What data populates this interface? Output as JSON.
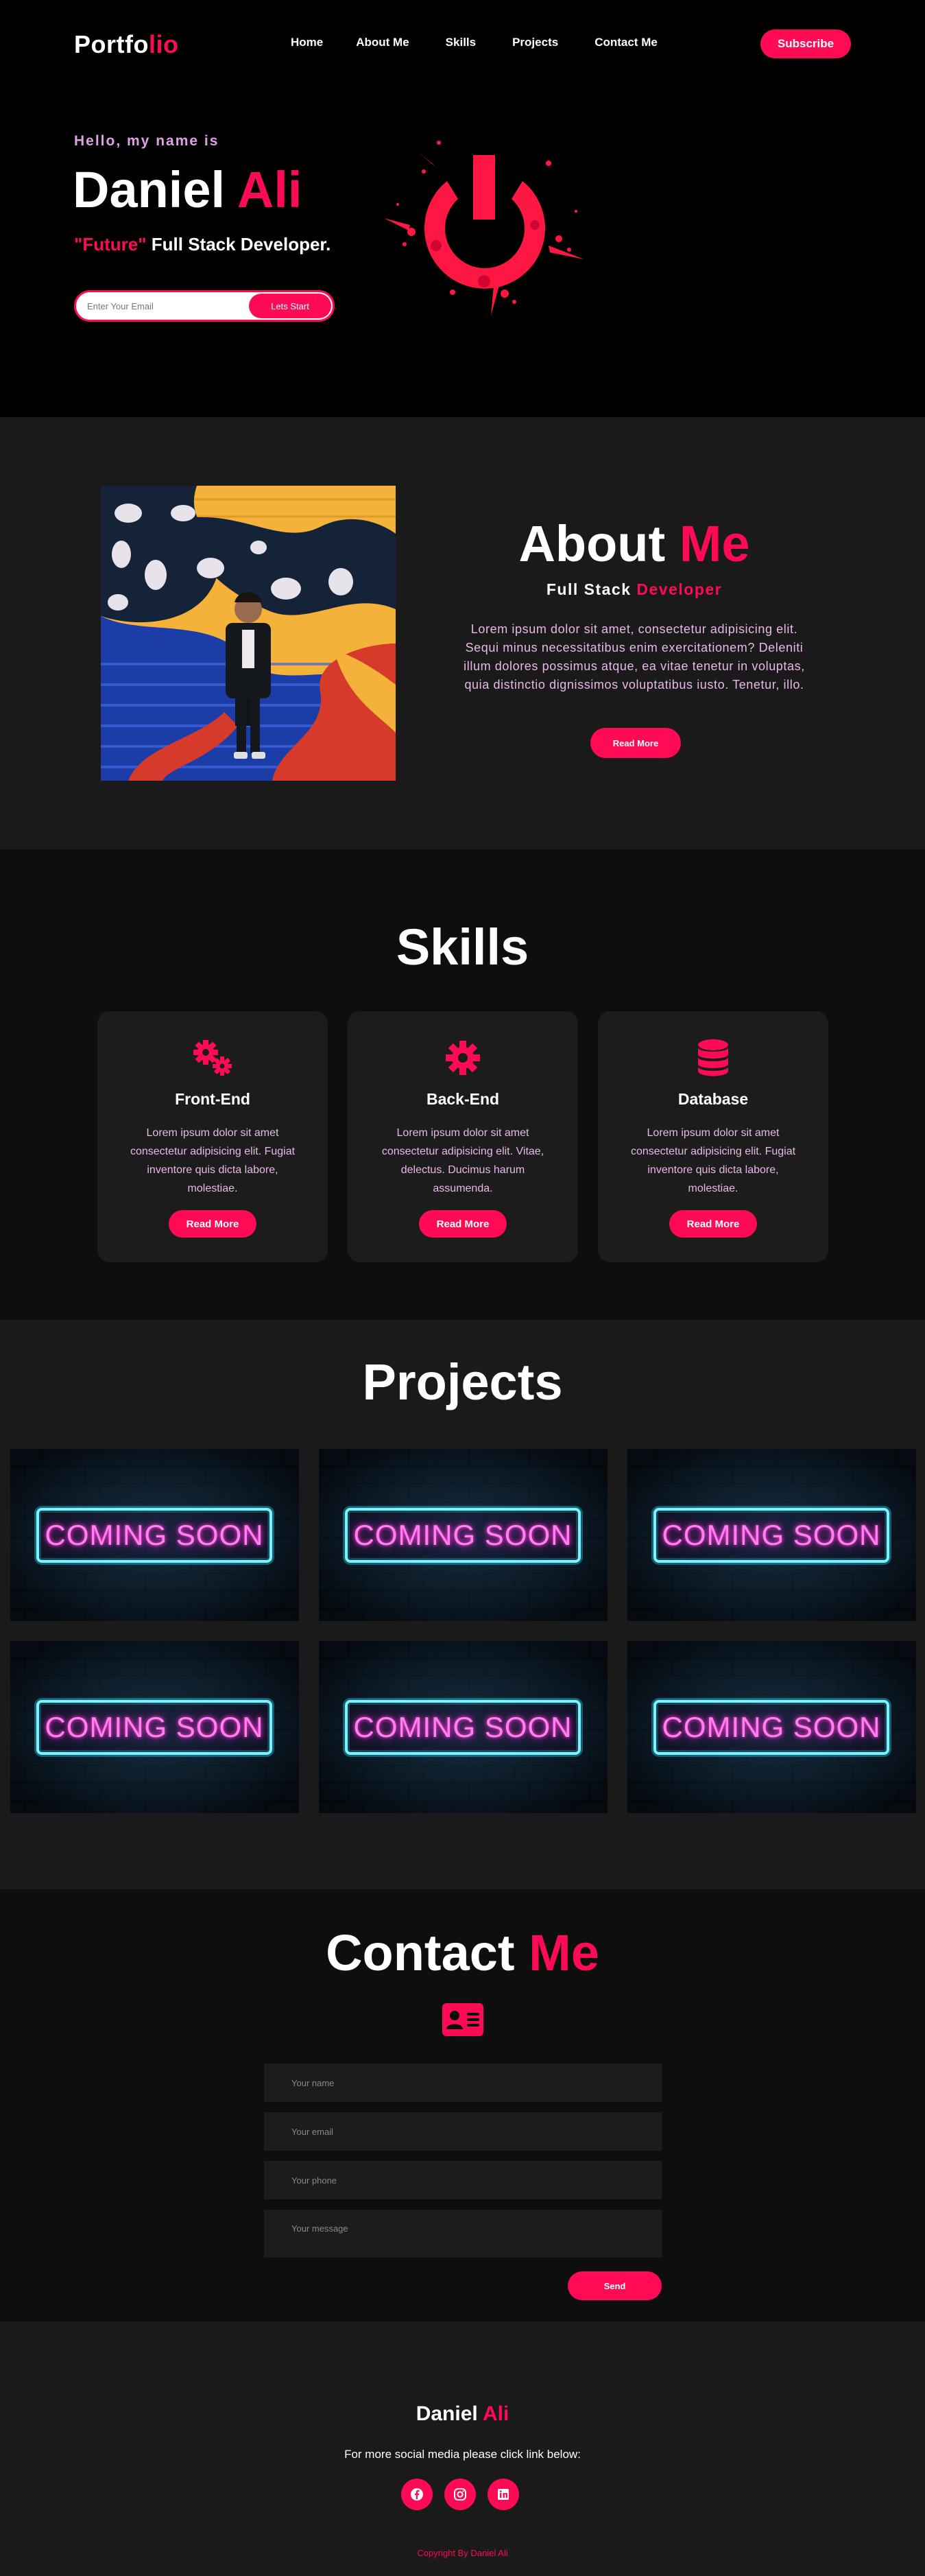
{
  "header": {
    "logo_main": "Portfo",
    "logo_accent": "lio",
    "nav": [
      "Home",
      "About Me",
      "Skills",
      "Projects",
      "Contact Me"
    ],
    "subscribe_label": "Subscribe"
  },
  "hero": {
    "greeting": "Hello, my name is",
    "first_name": "Daniel",
    "last_name": "Ali",
    "tag_accent": "\"Future\"",
    "tag_rest": " Full Stack Developer.",
    "email_placeholder": "Enter Your Email",
    "cta_label": "Lets Start"
  },
  "about": {
    "title_main": "About",
    "title_accent": "Me",
    "subtitle_main": "Full Stack",
    "subtitle_accent": "Developer",
    "text": "Lorem ipsum dolor sit amet, consectetur adipisicing elit. Sequi minus necessitatibus enim exercitationem? Deleniti illum dolores possimus atque, ea vitae tenetur in voluptas, quia distinctio dignissimos voluptatibus iusto. Tenetur, illo.",
    "button_label": "Read More"
  },
  "skills": {
    "title": "Skills",
    "cards": [
      {
        "title": "Front-End",
        "icon": "gears-icon",
        "text": "Lorem ipsum dolor sit amet consectetur adipisicing elit. Fugiat inventore quis dicta labore, molestiae.",
        "button": "Read More"
      },
      {
        "title": "Back-End",
        "icon": "gear-icon",
        "text": "Lorem ipsum dolor sit amet consectetur adipisicing elit. Vitae, delectus. Ducimus harum assumenda.",
        "button": "Read More"
      },
      {
        "title": "Database",
        "icon": "database-icon",
        "text": "Lorem ipsum dolor sit amet consectetur adipisicing elit. Fugiat inventore quis dicta labore, molestiae.",
        "button": "Read More"
      }
    ]
  },
  "projects": {
    "title": "Projects",
    "tiles": [
      "COMING SOON",
      "COMING SOON",
      "COMING SOON",
      "COMING SOON",
      "COMING SOON",
      "COMING SOON"
    ]
  },
  "contact": {
    "title_main": "Contact",
    "title_accent": "Me",
    "icon": "contact-card-icon",
    "name_placeholder": "Your name",
    "email_placeholder": "Your email",
    "phone_placeholder": "Your phone",
    "message_placeholder": "Your message",
    "send_label": "Send"
  },
  "footer": {
    "name_main": "Daniel",
    "name_accent": "Ali",
    "text": "For more social media please click link below:",
    "socials": [
      "facebook-icon",
      "instagram-icon",
      "linkedin-icon"
    ],
    "copyright": "Copyright By Daniel Ali"
  },
  "colors": {
    "accent": "#ff0a54",
    "lavender_text": "#e8b8ea",
    "dark_bg": "#0e0e0e",
    "panel_bg": "#1a1a1a"
  }
}
